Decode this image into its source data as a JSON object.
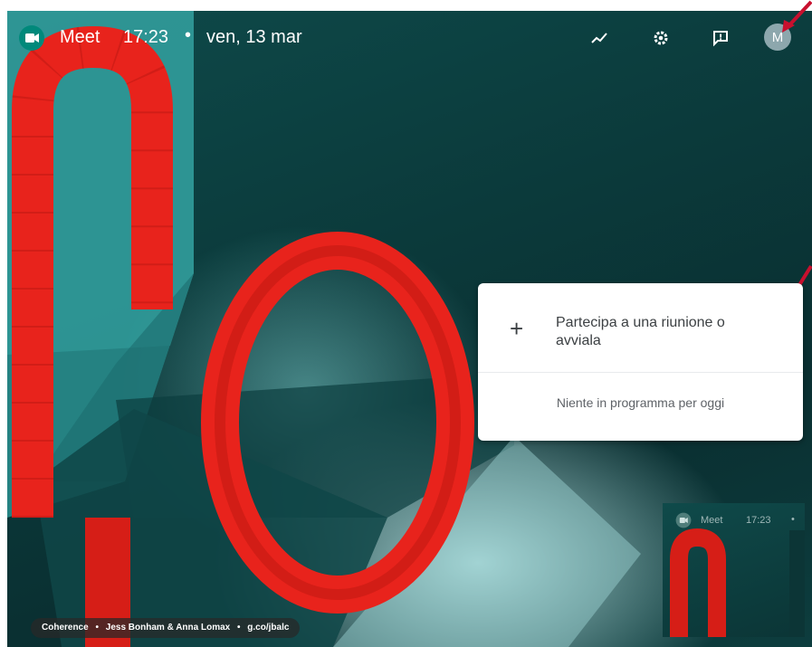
{
  "topbar": {
    "app_name": "Meet",
    "time": "17:23",
    "separator": "•",
    "date": "ven, 13 mar",
    "avatar_initial": "M",
    "icons": [
      "meet-logo-icon",
      "trending-icon",
      "gear-icon",
      "feedback-icon"
    ]
  },
  "card": {
    "join_label": "Partecipa a una riunione o avviala",
    "join_icon": "+",
    "empty_label": "Niente in programma per oggi"
  },
  "background_credit": {
    "title": "Coherence",
    "author": "Jess Bonham & Anna Lomax",
    "link": "g.co/jbalc",
    "separator": "•"
  },
  "thumbnail": {
    "app_name": "Meet",
    "time": "17:23",
    "separator": "•"
  },
  "colors": {
    "accent_red": "#e8231c",
    "meet_green": "#00897b",
    "background_teal": "#0b3a3b",
    "annotation_arrow": "#c8102e"
  }
}
